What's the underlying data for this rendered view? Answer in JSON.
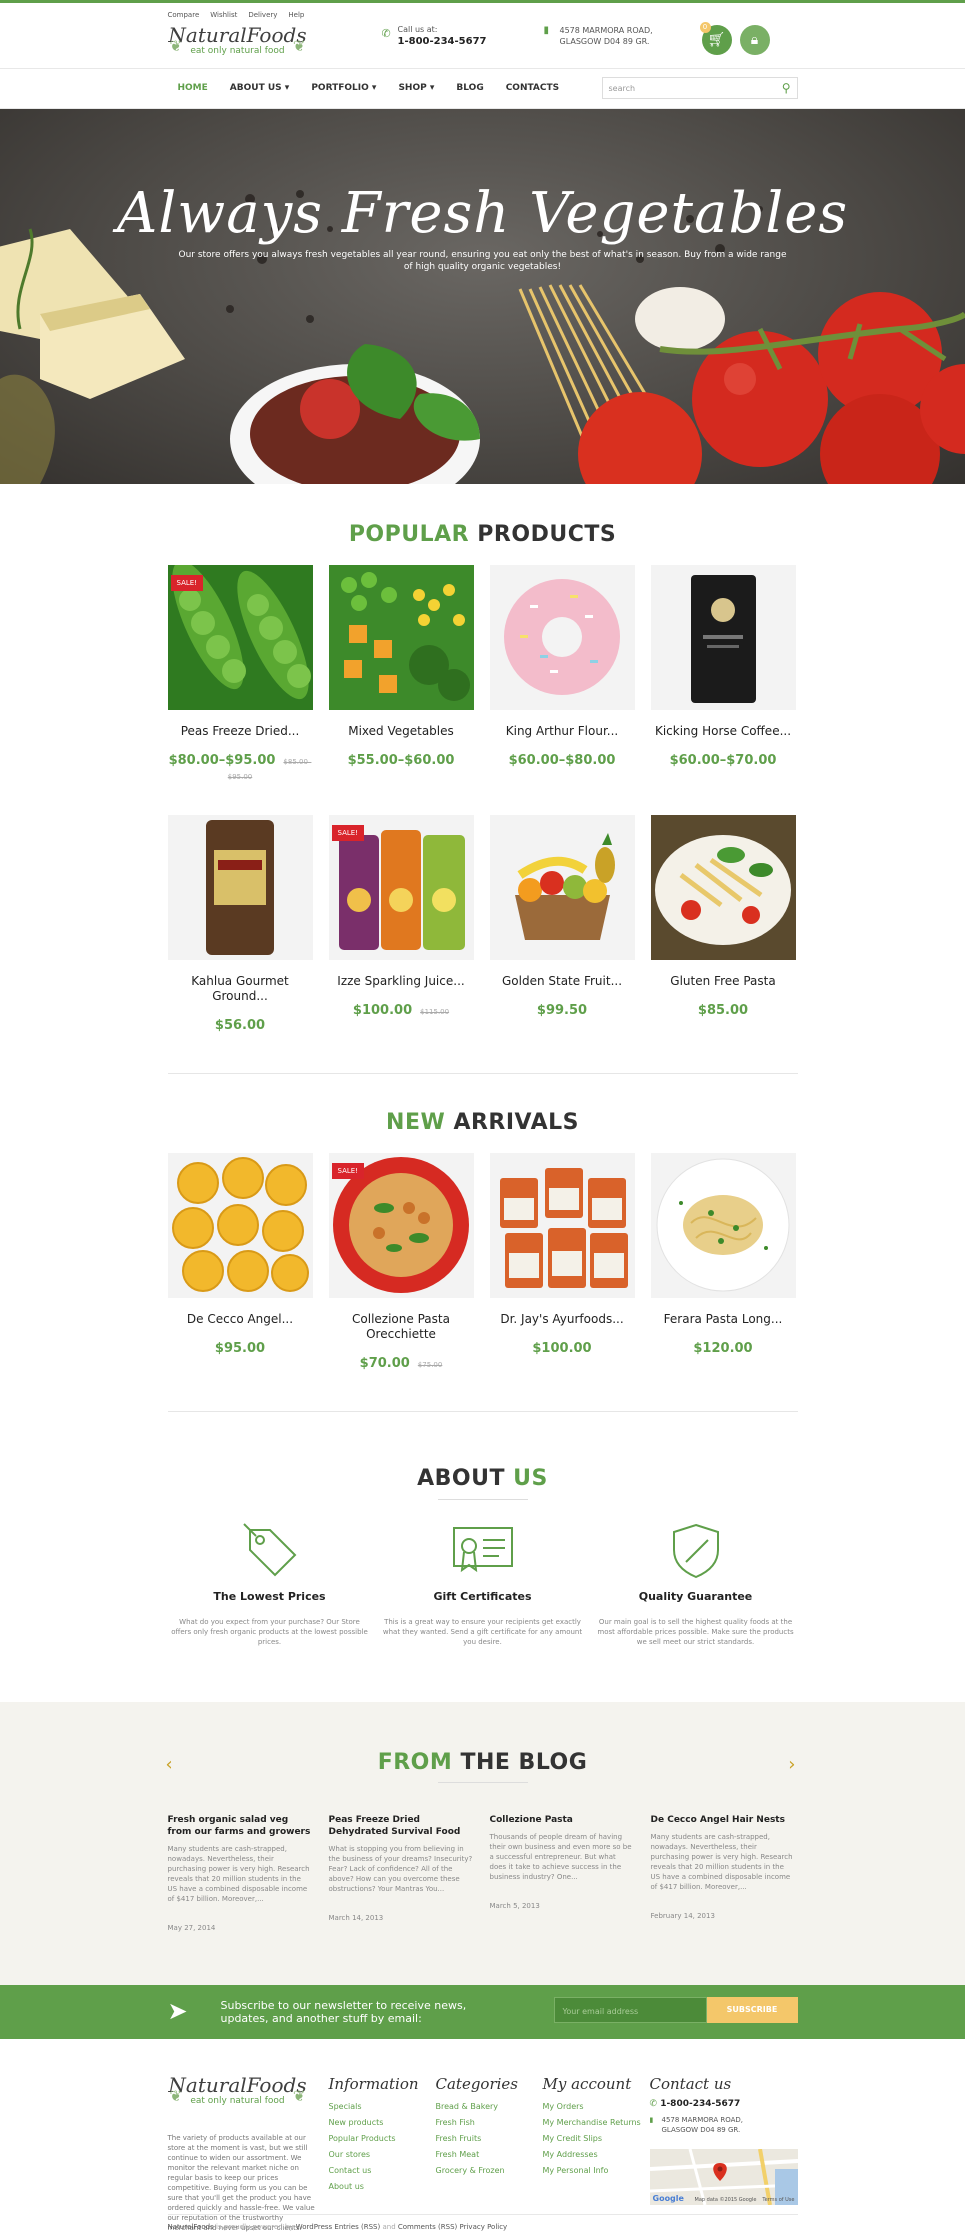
{
  "header": {
    "top_links": [
      "Compare",
      "Wishlist",
      "Delivery",
      "Help"
    ],
    "logo_name": "NaturalFoods",
    "logo_tagline": "eat only natural food",
    "call_label": "Call us at:",
    "phone": "1-800-234-5677",
    "address_line1": "4578 MARMORA ROAD,",
    "address_line2": "GLASGOW D04 89 GR.",
    "cart_count": "0"
  },
  "nav": {
    "items": [
      "HOME",
      "ABOUT US",
      "PORTFOLIO",
      "SHOP",
      "BLOG",
      "CONTACTS"
    ],
    "search_placeholder": "search"
  },
  "hero": {
    "title": "Always Fresh Vegetables",
    "text": "Our store offers you always fresh vegetables all year round, ensuring you eat only the best of what's in season. Buy from a wide range of high quality organic vegetables!"
  },
  "popular": {
    "title_accent": "POPULAR",
    "title_rest": "PRODUCTS",
    "products": [
      {
        "name": "Peas Freeze Dried...",
        "price": "$80.00–$95.00",
        "old": "$85.00–$95.00",
        "sale": "SALE!"
      },
      {
        "name": "Mixed Vegetables",
        "price": "$55.00–$60.00",
        "old": "",
        "sale": ""
      },
      {
        "name": "King Arthur Flour...",
        "price": "$60.00–$80.00",
        "old": "",
        "sale": ""
      },
      {
        "name": "Kicking Horse Coffee...",
        "price": "$60.00–$70.00",
        "old": "",
        "sale": ""
      },
      {
        "name": "Kahlua Gourmet Ground...",
        "price": "$56.00",
        "old": "",
        "sale": ""
      },
      {
        "name": "Izze Sparkling Juice...",
        "price": "$100.00",
        "old": "$115.00",
        "sale": "SALE!"
      },
      {
        "name": "Golden State Fruit...",
        "price": "$99.50",
        "old": "",
        "sale": ""
      },
      {
        "name": "Gluten Free Pasta",
        "price": "$85.00",
        "old": "",
        "sale": ""
      }
    ]
  },
  "arrivals": {
    "title_accent": "NEW",
    "title_rest": "ARRIVALS",
    "products": [
      {
        "name": "De Cecco Angel...",
        "price": "$95.00",
        "old": "",
        "sale": ""
      },
      {
        "name": "Collezione Pasta Orecchiette",
        "price": "$70.00",
        "old": "$75.00",
        "sale": "SALE!"
      },
      {
        "name": "Dr. Jay's Ayurfoods...",
        "price": "$100.00",
        "old": "",
        "sale": ""
      },
      {
        "name": "Ferara Pasta Long...",
        "price": "$120.00",
        "old": "",
        "sale": ""
      }
    ]
  },
  "about": {
    "title_rest": "ABOUT",
    "title_accent": "US",
    "features": [
      {
        "title": "The Lowest Prices",
        "text": "What do you expect from your purchase? Our Store offers only fresh organic products at the lowest possible prices."
      },
      {
        "title": "Gift Certificates",
        "text": "This is a great way to ensure your recipients get exactly what they wanted. Send a gift certificate for any amount you desire."
      },
      {
        "title": "Quality Guarantee",
        "text": "Our main goal is to sell the highest quality foods at the most affordable prices possible. Make sure the products we sell meet our strict standards."
      }
    ]
  },
  "blog": {
    "title_accent": "FROM",
    "title_rest": "THE BLOG",
    "posts": [
      {
        "title": "Fresh organic salad veg from our farms and growers",
        "text": "Many students are cash-strapped, nowadays. Nevertheless, their purchasing power is very high. Research reveals that 20 million students in the US have a combined disposable income of $417 billion. Moreover,...",
        "date": "May 27, 2014"
      },
      {
        "title": "Peas Freeze Dried Dehydrated Survival Food",
        "text": "What is stopping you from believing in the business of your dreams? Insecurity? Fear? Lack of confidence? All of the above? How can you overcome these obstructions? Your Mantras You...",
        "date": "March 14, 2013"
      },
      {
        "title": "Collezione Pasta",
        "text": "Thousands of people dream of having their own business and even more so be a successful entrepreneur. But what does it take to achieve success in the business industry? One...",
        "date": "March 5, 2013"
      },
      {
        "title": "De Cecco Angel Hair Nests",
        "text": "Many students are cash-strapped, nowadays. Nevertheless, their purchasing power is very high. Research reveals that 20 million students in the US have a combined disposable income of $417 billion. Moreover,...",
        "date": "February 14, 2013"
      }
    ]
  },
  "newsletter": {
    "text_line1": "Subscribe to our newsletter to receive news,",
    "text_line2": "updates, and another stuff by email:",
    "placeholder": "Your email address",
    "button": "SUBSCRIBE"
  },
  "footer": {
    "about_text": "The variety of products available at our store at the moment is vast, but we still continue to widen our assortment. We monitor the relevant market niche on regular basis to keep our prices competitive. Buying form us you can be sure that you'll get the product you have ordered quickly and hassle-free. We value our reputation of the trustworthy merchant and never upset our clients.",
    "information_title": "Information",
    "information": [
      "Specials",
      "New products",
      "Popular Products",
      "Our stores",
      "Contact us",
      "About us"
    ],
    "categories_title": "Categories",
    "categories": [
      "Bread & Bakery",
      "Fresh Fish",
      "Fresh Fruits",
      "Fresh Meat",
      "Grocery & Frozen"
    ],
    "account_title": "My account",
    "account": [
      "My Orders",
      "My Merchandise Returns",
      "My Credit Slips",
      "My Addresses",
      "My Personal Info"
    ],
    "contact_title": "Contact us",
    "contact_phone": "1-800-234-5677",
    "contact_addr1": "4578 MARMORA ROAD,",
    "contact_addr2": "GLASGOW D04 89 GR.",
    "map_google": "Google",
    "map_credit": "Map data ©2015 Google",
    "map_terms": "Terms of Use",
    "copyright_brand": "NaturalFoods",
    "copyright_mid": "is proudly powered by",
    "copyright_link1": "WordPress",
    "copyright_link2": "Entries (RSS)",
    "copyright_and": "and",
    "copyright_link3": "Comments (RSS)",
    "copyright_link4": "Privacy Policy"
  },
  "colors": {
    "accent": "#5f9f4a",
    "sale": "#d9242b",
    "button": "#f4c76a",
    "blog_bg": "#f4f3ee"
  }
}
